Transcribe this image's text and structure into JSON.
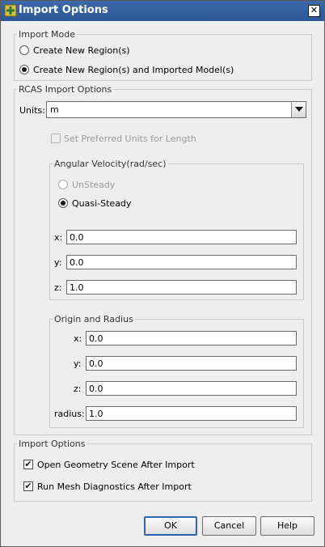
{
  "window": {
    "title": "Import Options"
  },
  "import_mode": {
    "label": "Import Mode",
    "options": [
      "Create New Region(s)",
      "Create New Region(s) and Imported Model(s)"
    ],
    "selected_index": 1
  },
  "rcas": {
    "label": "RCAS Import Options",
    "units_label": "Units:",
    "units_value": "m",
    "preferred_units_label": "Set Preferred Units for Length",
    "angular": {
      "label": "Angular Velocity(rad/sec)",
      "unsteady_label": "UnSteady",
      "quasi_label": "Quasi-Steady",
      "x_label": "x:",
      "x_value": "0.0",
      "y_label": "y:",
      "y_value": "0.0",
      "z_label": "z:",
      "z_value": "1.0"
    },
    "origin": {
      "label": "Origin and Radius",
      "x_label": "x:",
      "x_value": "0.0",
      "y_label": "y:",
      "y_value": "0.0",
      "z_label": "z:",
      "z_value": "0.0",
      "radius_label": "radius:",
      "radius_value": "1.0"
    }
  },
  "import_options": {
    "label": "Import Options",
    "open_geometry_label": "Open Geometry Scene After Import",
    "run_mesh_label": "Run Mesh Diagnostics After Import",
    "open_geometry_checked": true,
    "run_mesh_checked": true
  },
  "buttons": {
    "ok": "OK",
    "cancel": "Cancel",
    "help": "Help"
  }
}
